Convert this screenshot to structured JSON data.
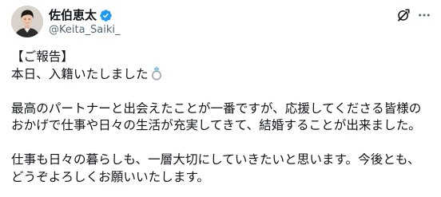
{
  "post": {
    "author": {
      "name": "佐伯恵太",
      "handle": "@Keita_Saiki_",
      "verified_icon": "verified-badge-icon",
      "avatar": "profile-photo"
    },
    "actions": {
      "grok_icon": "grok-icon",
      "more_icon": "more-options-icon"
    },
    "text": {
      "line1": "【ご報告】",
      "line2": "本日、入籍いたしました",
      "line2_emoji": "ring-emoji-icon",
      "line3": "最高のパートナーと出会えたことが一番ですが、応援してくださる皆様の",
      "line4": "おかげで仕事や日々の生活が充実してきて、結婚することが出来ました。",
      "line5": "仕事も日々の暮らしも、一層大切にしていきたいと思います。今後とも、",
      "line6": "どうぞよろしくお願いいたします。"
    },
    "colors": {
      "text": "#0f1419",
      "secondary_text": "#536471",
      "verified_blue": "#1d9bf0"
    }
  }
}
